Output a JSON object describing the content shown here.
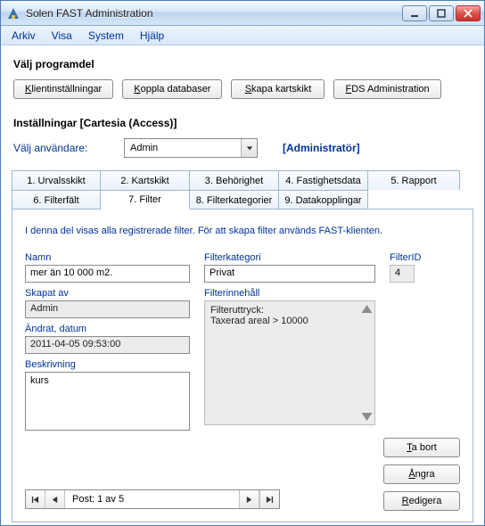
{
  "window": {
    "title": "Solen FAST Administration"
  },
  "menu": {
    "arkiv": "Arkiv",
    "visa": "Visa",
    "system": "System",
    "hjalp": "Hjälp"
  },
  "top": {
    "heading": "Välj programdel",
    "btn_klient": "Klientinställningar",
    "btn_koppla": "Koppla databaser",
    "btn_skapa": "Skapa kartskikt",
    "btn_fds": "FDS Administration"
  },
  "settings": {
    "heading": "Inställningar [Cartesia (Access)]",
    "user_label": "Välj användare:",
    "user_value": "Admin",
    "role": "[Administratör]"
  },
  "tabs": {
    "t1": "1. Urvalsskikt",
    "t2": "2. Kartskikt",
    "t3": "3. Behörighet",
    "t4": "4. Fastighetsdata",
    "t5": "5. Rapport",
    "t6": "6. Filterfält",
    "t7": "7. Filter",
    "t8": "8. Filterkategorier",
    "t9": "9. Datakopplingar"
  },
  "filter": {
    "hint": "I denna del visas alla registrerade filter. För att skapa filter används FAST-klienten.",
    "name_label": "Namn",
    "name_value": "mer än 10 000 m2.",
    "created_by_label": "Skapat av",
    "created_by_value": "Admin",
    "modified_label": "Ändrat, datum",
    "modified_value": "2011-04-05 09:53:00",
    "desc_label": "Beskrivning",
    "desc_value": "kurs",
    "cat_label": "Filterkategori",
    "cat_value": "Privat",
    "content_label": "Filterinnehåll",
    "content_line1": "Filteruttryck:",
    "content_line2": "Taxerad areal > 10000",
    "id_label": "FilterID",
    "id_value": "4"
  },
  "actions": {
    "delete": "Ta bort",
    "undo": "Ångra",
    "edit": "Redigera"
  },
  "nav": {
    "status": "Post: 1 av 5"
  }
}
